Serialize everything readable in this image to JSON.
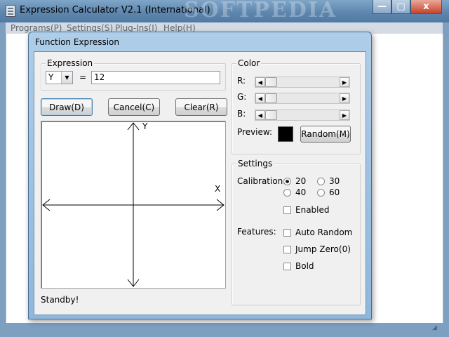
{
  "window": {
    "title": "Expression Calculator V2.1 (International)",
    "watermark": "SOFTPEDIA",
    "controls": {
      "minimize": "—",
      "maximize": "□",
      "close": "x"
    }
  },
  "menu": [
    {
      "label": "Programs(P)"
    },
    {
      "label": "Settings(S)"
    },
    {
      "label": "Plug-Ins(I)"
    },
    {
      "label": "Help(H)"
    }
  ],
  "dialog": {
    "title": "Function Expression",
    "expression": {
      "group_label": "Expression",
      "variable": "Y",
      "equals": "=",
      "value": "12"
    },
    "buttons": {
      "draw": "Draw(D)",
      "cancel": "Cancel(C)",
      "clear": "Clear(R)",
      "random": "Random(M)"
    },
    "graph": {
      "x_label": "X",
      "y_label": "Y"
    },
    "status": "Standby!",
    "color": {
      "group_label": "Color",
      "r_label": "R:",
      "g_label": "G:",
      "b_label": "B:",
      "preview_label": "Preview:",
      "preview_color": "#000000",
      "r_value": 0,
      "g_value": 0,
      "b_value": 0
    },
    "settings": {
      "group_label": "Settings",
      "calibration_label": "Calibration:",
      "calibration_options": [
        "20",
        "30",
        "40",
        "60"
      ],
      "calibration_selected": "20",
      "enabled_label": "Enabled",
      "enabled_checked": false,
      "features_label": "Features:",
      "features": [
        {
          "label": "Auto Random",
          "checked": false
        },
        {
          "label": "Jump Zero(0)",
          "checked": false
        },
        {
          "label": "Bold",
          "checked": false
        }
      ]
    }
  }
}
